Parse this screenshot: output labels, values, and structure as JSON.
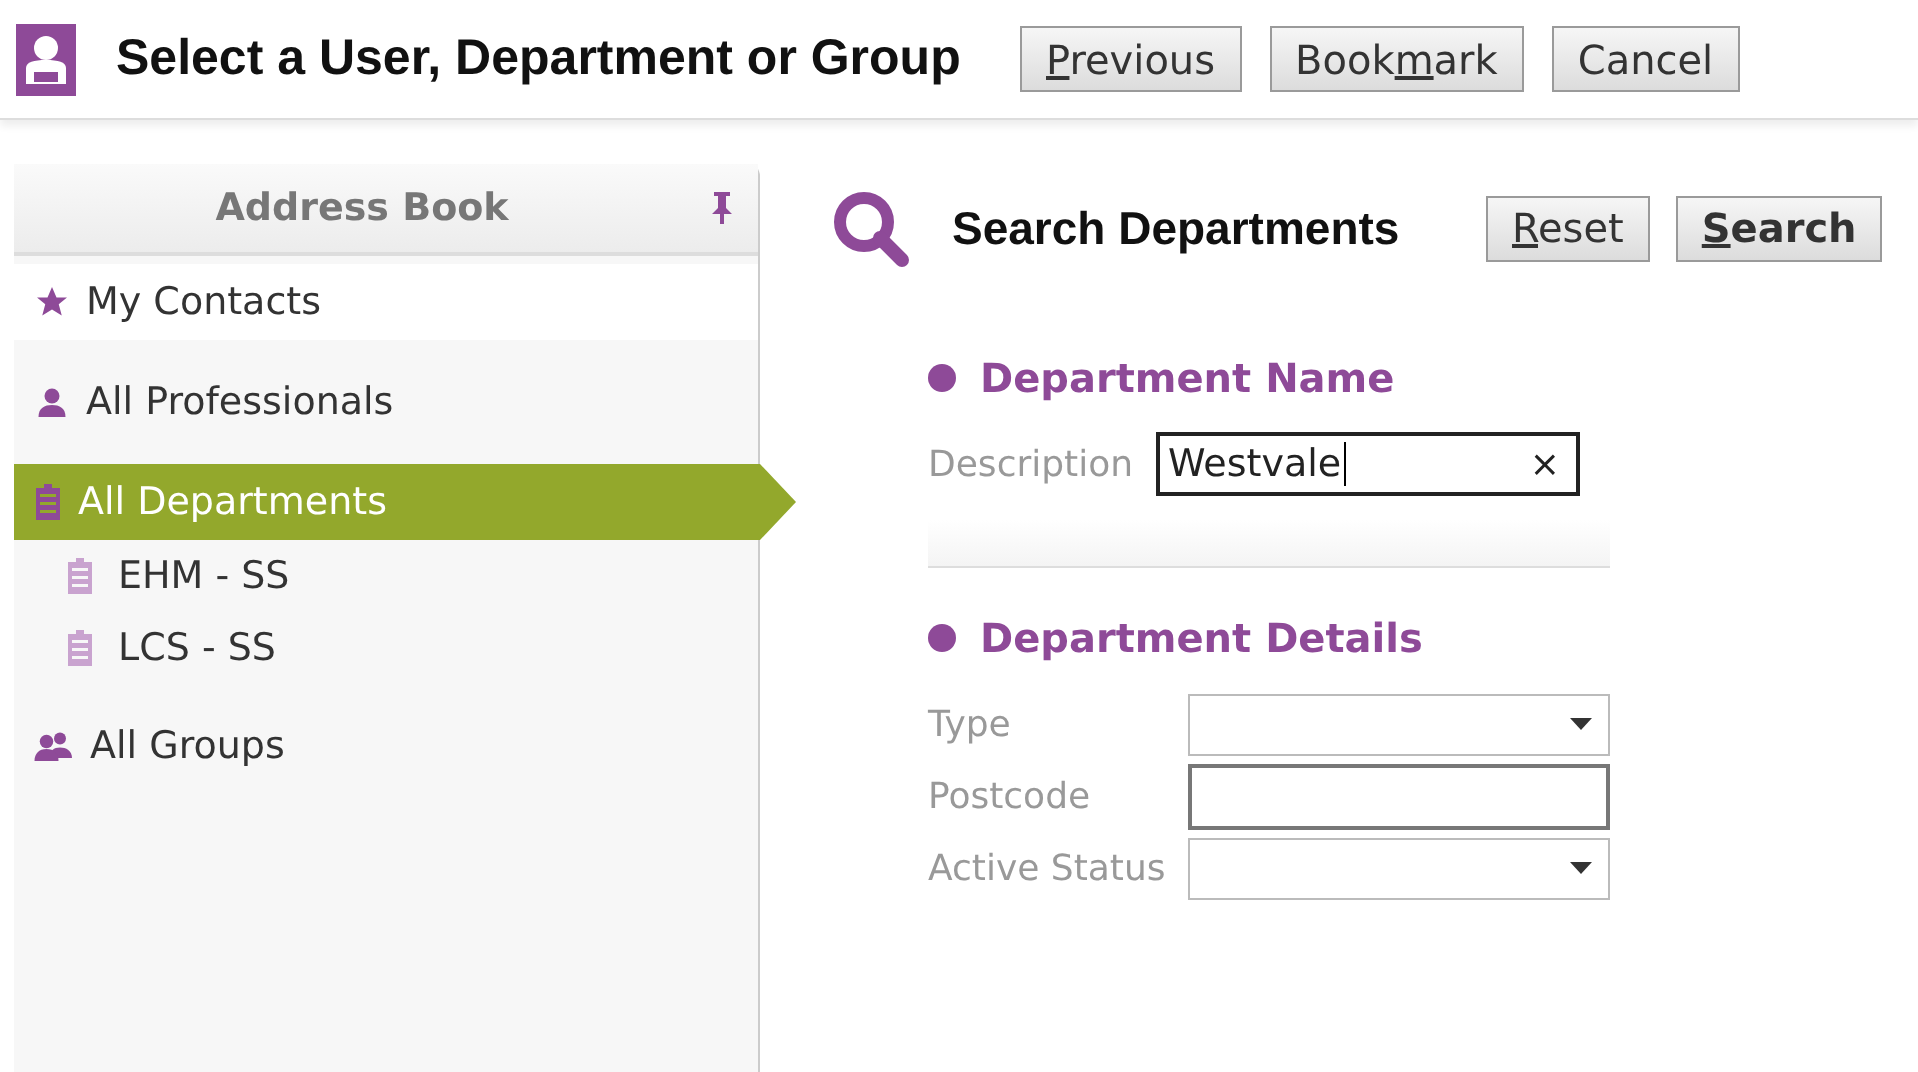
{
  "window": {
    "title": "Select a User, Department or Group"
  },
  "header_buttons": [
    {
      "key": "P",
      "after": "revious"
    },
    {
      "before": "Book",
      "key": "m",
      "after": "ark"
    },
    {
      "before": "Cancel"
    }
  ],
  "sidebar": {
    "title": "Address Book",
    "items": [
      {
        "kind": "star",
        "label": "My Contacts",
        "selected": false
      },
      {
        "kind": "person",
        "label": "All Professionals",
        "selected": false
      },
      {
        "kind": "building",
        "label": "All Departments",
        "selected": true,
        "children": [
          {
            "kind": "building",
            "label": "EHM  - SS",
            "selected": false
          },
          {
            "kind": "building",
            "label": "LCS  - SS",
            "selected": false
          }
        ]
      },
      {
        "kind": "group",
        "label": "All Groups",
        "selected": false
      }
    ]
  },
  "search": {
    "title": "Search Departments",
    "buttons": [
      {
        "key": "R",
        "after": "eset",
        "bold": false
      },
      {
        "key": "S",
        "after": "earch",
        "bold": true
      }
    ],
    "sections": [
      {
        "title": "Department Name",
        "fields": [
          {
            "kind": "text_clear",
            "label": "Description",
            "value": "Westvale",
            "clear": "×"
          }
        ]
      },
      {
        "title": "Department Details",
        "fields": [
          {
            "kind": "select",
            "label": "Type"
          },
          {
            "kind": "text",
            "label": "Postcode"
          },
          {
            "kind": "select",
            "label": "Active Status"
          }
        ]
      }
    ]
  }
}
